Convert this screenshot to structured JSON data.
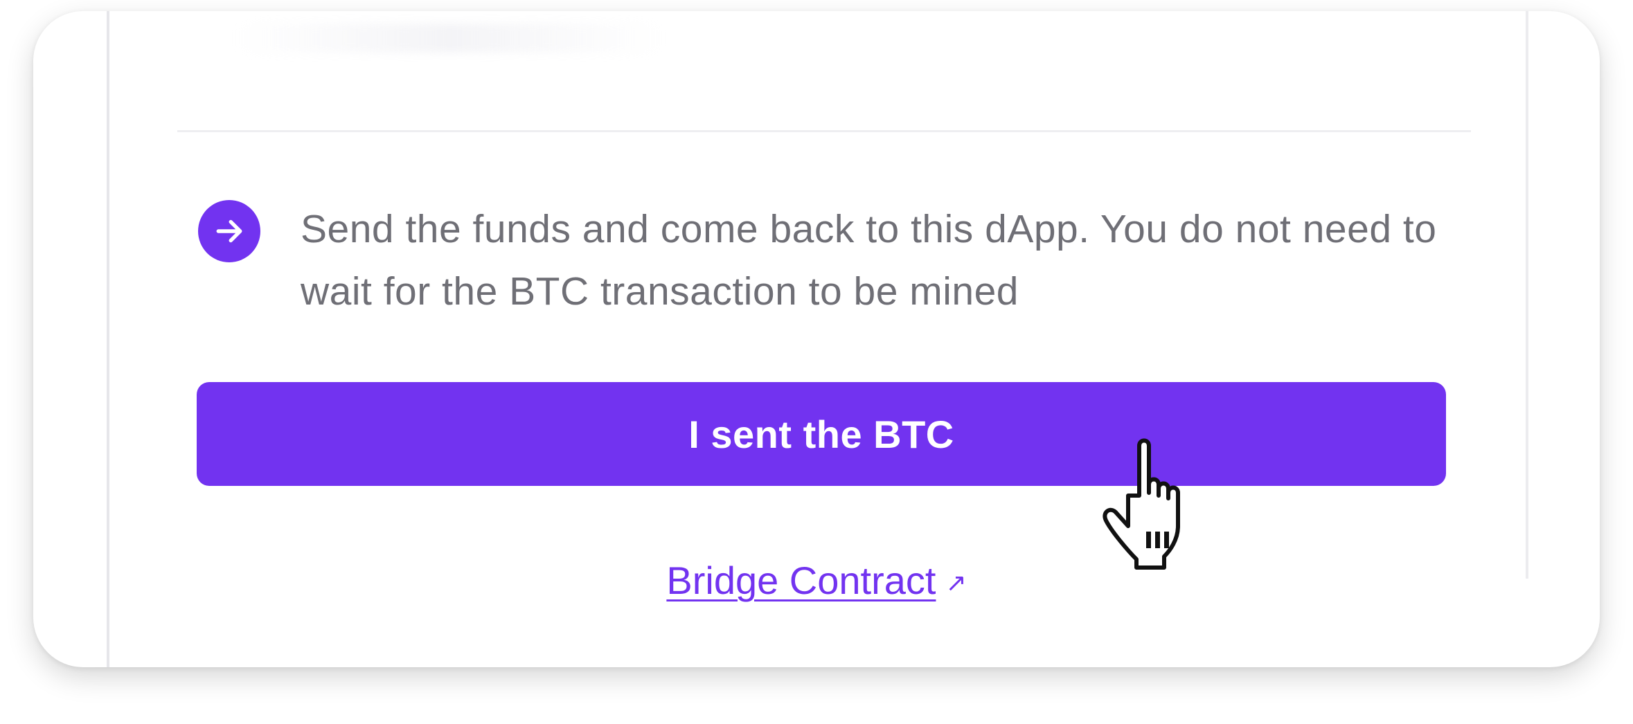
{
  "step": {
    "icon": "arrow-right-icon",
    "text": "Send the funds and come back to this dApp. You do not need to wait for the BTC transaction to be mined"
  },
  "actions": {
    "primary_label": "I sent the BTC",
    "link_label": "Bridge Contract",
    "link_icon": "external-link-icon"
  },
  "cursor": {
    "icon": "hand-pointer-cursor-icon"
  },
  "colors": {
    "accent": "#7233f0",
    "body_text": "#6f6f76",
    "background": "#ffffff"
  }
}
